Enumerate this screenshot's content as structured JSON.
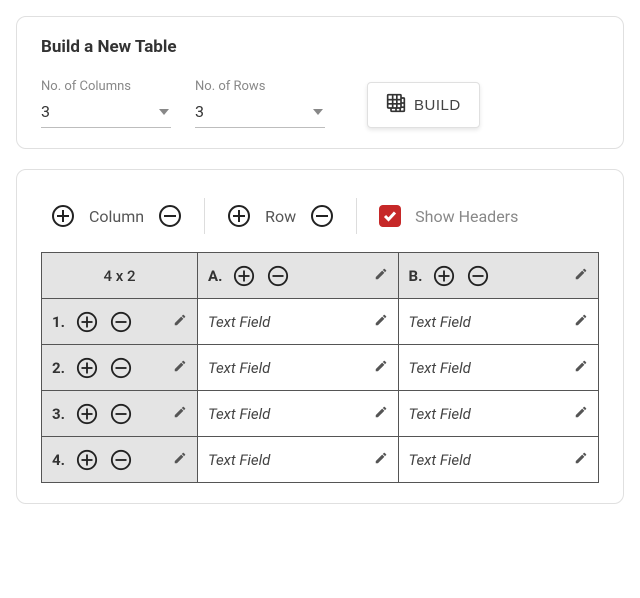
{
  "builder": {
    "title": "Build a New Table",
    "columns": {
      "label": "No. of Columns",
      "value": "3"
    },
    "rows": {
      "label": "No. of Rows",
      "value": "3"
    },
    "build_label": "BUILD"
  },
  "toolbar": {
    "column_label": "Column",
    "row_label": "Row",
    "show_headers_label": "Show Headers",
    "show_headers_checked": true
  },
  "table": {
    "dim_label": "4 x 2",
    "col_headers": [
      "A.",
      "B."
    ],
    "row_headers": [
      "1.",
      "2.",
      "3.",
      "4."
    ],
    "cell_placeholder": "Text Field"
  }
}
